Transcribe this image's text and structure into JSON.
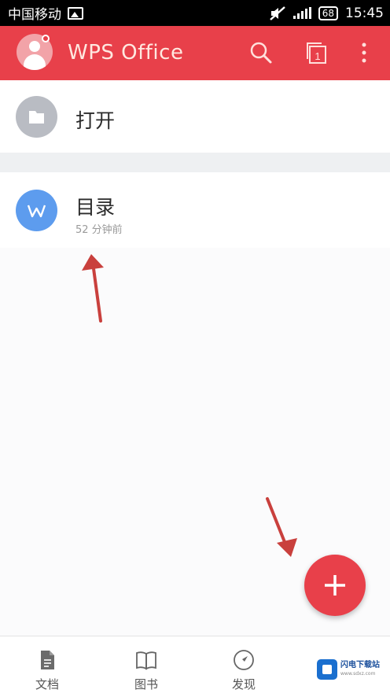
{
  "status_bar": {
    "carrier": "中国移动",
    "battery": "68",
    "time": "15:45"
  },
  "app_bar": {
    "title": "WPS Office",
    "icons": [
      "avatar",
      "search-icon",
      "tabs-icon",
      "more-vert-icon"
    ],
    "tab_count": "1",
    "accent_color": "#e8404a"
  },
  "open_row": {
    "label": "打开",
    "icon": "folder-icon"
  },
  "recent_files": [
    {
      "name": "目录",
      "time": "52 分钟前",
      "icon": "wps-writer-icon",
      "icon_color": "#5d9cee"
    }
  ],
  "fab": {
    "icon": "plus-icon"
  },
  "bottom_nav": {
    "items": [
      {
        "label": "文档",
        "icon": "document-icon"
      },
      {
        "label": "图书",
        "icon": "book-icon"
      },
      {
        "label": "发现",
        "icon": "compass-icon"
      }
    ]
  },
  "watermark": {
    "text": "闪电下载站",
    "sub": "www.sdxz.com"
  }
}
